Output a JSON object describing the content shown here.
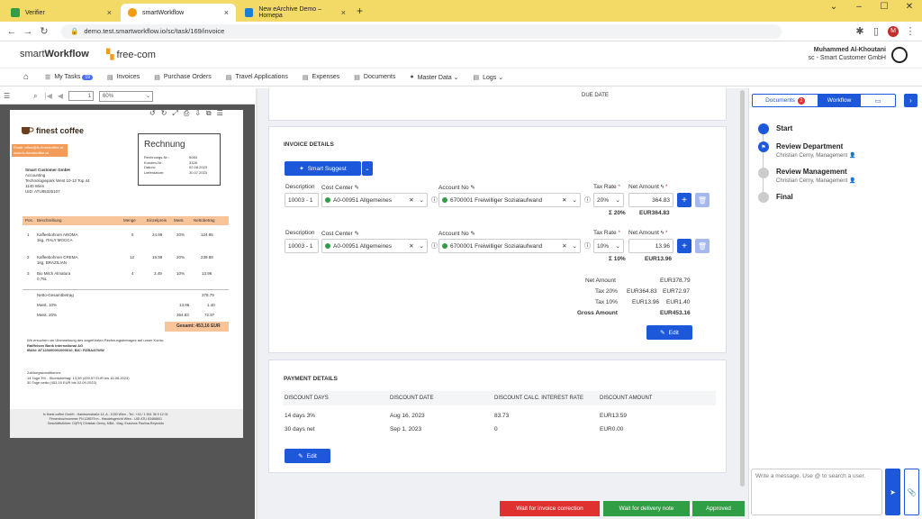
{
  "browser": {
    "tabs": [
      {
        "title": "Verifier",
        "fav_color": "#2f9e44"
      },
      {
        "title": "smartWorkflow",
        "fav_color": "#f39c12"
      },
      {
        "title": "New eArchive Demo – Homepa",
        "fav_color": "#1c7ed6"
      }
    ],
    "url": "demo.test.smartworkflow.io/sc/task/169/invoice"
  },
  "header": {
    "logo_prefix": "smart",
    "logo_bold": "Workflow",
    "brand": "free-com",
    "user_name": "Muhammed Al-Khoutani",
    "user_company": "sc - Smart Customer GmbH"
  },
  "menu": [
    {
      "label": "My Tasks",
      "badge": "19",
      "icon": "☰"
    },
    {
      "label": "Invoices",
      "icon": "▤"
    },
    {
      "label": "Purchase Orders",
      "icon": "▤"
    },
    {
      "label": "Travel Applications",
      "icon": "▤"
    },
    {
      "label": "Expenses",
      "icon": "▤"
    },
    {
      "label": "Documents",
      "icon": "▤"
    },
    {
      "label": "Master Data ⌄",
      "icon": "●"
    },
    {
      "label": "Logs ⌄",
      "icon": "▤"
    }
  ],
  "pdf": {
    "zoom": "60%",
    "page": "1",
    "company": "finest coffee",
    "email_line": "Email: office@fc-finestcoffee.at",
    "web_line": "www.fc-finestcoffee.at",
    "recipient": [
      "Smart Customer GmbH",
      "Accounting",
      "Technologiepark West 10-12 Top 44",
      "1140 Wien",
      "UID: ATU85325107"
    ],
    "rechnung": "Rechnung",
    "meta_labels": [
      "Rechnungs-Nr.:",
      "Kunden-Nr:",
      "Datum:",
      "Lieferdatum:"
    ],
    "meta_values": [
      "5083",
      "3328",
      "02.08.2023",
      "30.07.2023"
    ],
    "table_headers": [
      "Pos.",
      "Beschreibung",
      "Menge",
      "Einzelpreis",
      "Mwst.",
      "Nettobetrag"
    ],
    "rows": [
      {
        "pos": "1",
        "desc1": "Kaffeebohnen AROMA",
        "desc2": "1kg, ITALY MOCCA",
        "qty": "5",
        "price": "24.99",
        "vat": "20%",
        "net": "124.95"
      },
      {
        "pos": "2",
        "desc1": "Kaffeebohnen CREMA",
        "desc2": "1kg, BRAZILIAN",
        "qty": "12",
        "price": "19.99",
        "vat": "20%",
        "net": "239.88"
      },
      {
        "pos": "3",
        "desc1": "Bio Milch Almatura",
        "desc2": "0,75L",
        "qty": "4",
        "price": "3.49",
        "vat": "10%",
        "net": "13.96"
      }
    ],
    "netto_label": "Netto-Gesamtbetrag",
    "netto_value": "378.79",
    "mwst10_label": "Mwst. 10%",
    "mwst10_base": "13.96",
    "mwst10_value": "1.40",
    "mwst20_label": "Mwst. 20%",
    "mwst20_base": "364.83",
    "mwst20_value": "72.97",
    "total": "Gesamt: 453,16 EUR",
    "pay_line1": "Wir ersuchen um Überweisung des angeführten Rechnungsbetrages auf unser Konto:",
    "pay_line2": "Raiffeisen Bank International AG",
    "pay_line3": "IBAN: AT123000001000010, BIC: RZBAATWW",
    "terms_title": "Zahlungskonditionen:",
    "terms1": "14 Tage 3% - Skontobetrag: 13,59 (439,57 EUR bis 16.08.2023)",
    "terms2": "30 Tage netto (453,16 EUR bis 02.09.2023)",
    "footer1": "fc finest coffee GmbH - Hainbuerstraße 14, A - 1030 Wien - Tel.: +43 / 1 501 36 9 12 01",
    "footer2": "Firmenbuchnummer FN 128579 m - Handelsgericht Wien - UID ATU 63466601",
    "footer3": "Geschäftsführer: DI(FH) Christian Gerny, MBA - Mag. Erasmus Paolina-Reynolds"
  },
  "center": {
    "due_date_label": "DUE DATE",
    "invoice_details_title": "INVOICE DETAILS",
    "smart_suggest": "Smart Suggest",
    "lines": [
      {
        "desc_label": "Description",
        "desc": "10003 - 1",
        "cc_label": "Cost Center",
        "cc": "A0-00951 Allgemeines",
        "acc_label": "Account No",
        "acc": "6700001 Freiwilliger Sozialaufwand",
        "tax_label": "Tax Rate",
        "tax": "20%",
        "net_label": "Net Amount",
        "net": "364.83",
        "sum_tax": "Σ 20%",
        "sum_amt": "EUR364.83"
      },
      {
        "desc_label": "Description",
        "desc": "10003 - 1",
        "cc_label": "Cost Center",
        "cc": "A0-00951 Allgemeines",
        "acc_label": "Account No",
        "acc": "6700001 Freiwilliger Sozialaufwand",
        "tax_label": "Tax Rate",
        "tax": "10%",
        "net_label": "Net Amount",
        "net": "13.96",
        "sum_tax": "Σ 10%",
        "sum_amt": "EUR13.96"
      }
    ],
    "summary": {
      "net_label": "Net Amount",
      "net": "EUR378.79",
      "tax20_label": "Tax 20%",
      "tax20_base": "EUR364.83",
      "tax20": "EUR72.97",
      "tax10_label": "Tax 10%",
      "tax10_base": "EUR13.96",
      "tax10": "EUR1.40",
      "gross_label": "Gross Amount",
      "gross": "EUR453.16"
    },
    "edit_label": "Edit",
    "payment_title": "PAYMENT DETAILS",
    "pay_headers": [
      "DISCOUNT DAYS",
      "DISCOUNT DATE",
      "DISCOUNT CALC. INTEREST RATE",
      "DISCOUNT AMOUNT"
    ],
    "pay_rows": [
      [
        "14 days 3%",
        "Aug 16, 2023",
        "83.73",
        "EUR13.59"
      ],
      [
        "30 days net",
        "Sep 1, 2023",
        "0",
        "EUR0.00"
      ]
    ],
    "pay_edit_label": "Edit"
  },
  "actions": {
    "wait_correction": "Wait for invoice correction",
    "wait_delivery": "Wait for delivery note",
    "approved": "Approved"
  },
  "right": {
    "tab_documents": "Documents",
    "tab_documents_badge": "2",
    "tab_workflow": "Workflow",
    "steps": [
      {
        "title": "Start",
        "sub": ""
      },
      {
        "title": "Review Department",
        "sub": "Christian Cerny, Management"
      },
      {
        "title": "Review Management",
        "sub": "Christian Cerny, Management"
      },
      {
        "title": "Final",
        "sub": ""
      }
    ],
    "message_placeholder": "Write a message. Use @ to search a user."
  },
  "colors": {
    "primary": "#1c58d9",
    "danger": "#e03131",
    "success": "#2f9e44",
    "accent": "#f39c12",
    "pdf_orange": "#f8c49a"
  }
}
